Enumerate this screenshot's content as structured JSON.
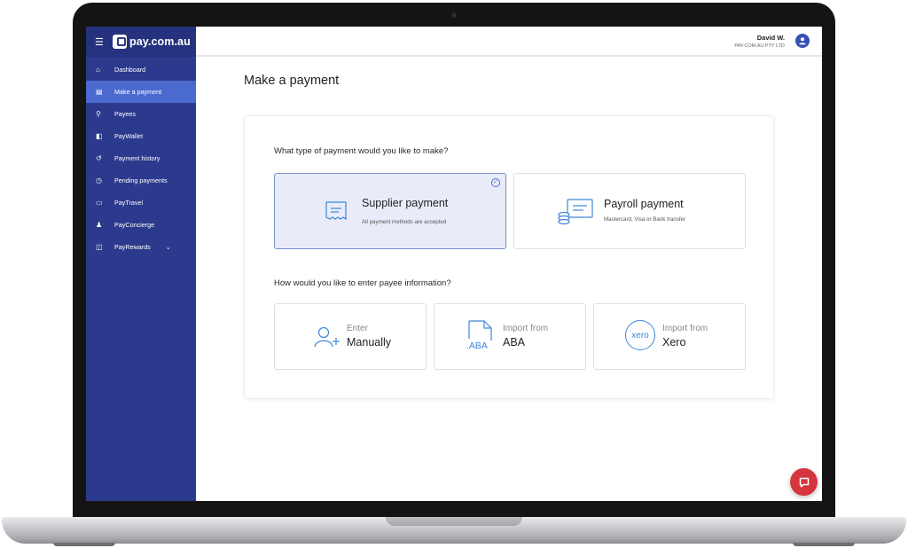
{
  "app": {
    "brand": "pay.com.au",
    "menu_icon": "hamburger-icon"
  },
  "user": {
    "name": "David W.",
    "org": "PAY.COM.AU PTY LTD",
    "avatar_icon": "user-icon"
  },
  "sidebar": {
    "items": [
      {
        "label": "Dashboard",
        "icon": "home-icon",
        "glyph": "⌂"
      },
      {
        "label": "Make a payment",
        "icon": "payment-icon",
        "glyph": "▤",
        "active": true
      },
      {
        "label": "Payees",
        "icon": "payees-icon",
        "glyph": "⚲"
      },
      {
        "label": "PayWallet",
        "icon": "wallet-icon",
        "glyph": "◧"
      },
      {
        "label": "Payment history",
        "icon": "history-icon",
        "glyph": "↺"
      },
      {
        "label": "Pending payments",
        "icon": "clock-icon",
        "glyph": "◷"
      },
      {
        "label": "PayTravel",
        "icon": "travel-icon",
        "glyph": "▭"
      },
      {
        "label": "PayConcierge",
        "icon": "concierge-icon",
        "glyph": "♟"
      },
      {
        "label": "PayRewards",
        "icon": "rewards-icon",
        "glyph": "◫",
        "chevron": "⌄"
      }
    ]
  },
  "main": {
    "title": "Make a payment",
    "question1": "What type of payment would you like to make?",
    "payment_types": [
      {
        "title": "Supplier payment",
        "subtitle": "All payment methods are accepted",
        "selected": true
      },
      {
        "title": "Payroll payment",
        "subtitle": "Mastercard, Visa or Bank transfer",
        "selected": false
      }
    ],
    "question2": "How would you like to enter payee information?",
    "entry_methods": [
      {
        "top": "Enter",
        "bottom": "Manually"
      },
      {
        "top": "Import from",
        "bottom": "ABA",
        "icon_text": ".ABA"
      },
      {
        "top": "Import from",
        "bottom": "Xero",
        "icon_text": "xero"
      }
    ]
  },
  "colors": {
    "sidebar": "#2b3a8c",
    "active": "#4b6ad0",
    "accent": "#3d86d8",
    "chat": "#d6353f"
  }
}
